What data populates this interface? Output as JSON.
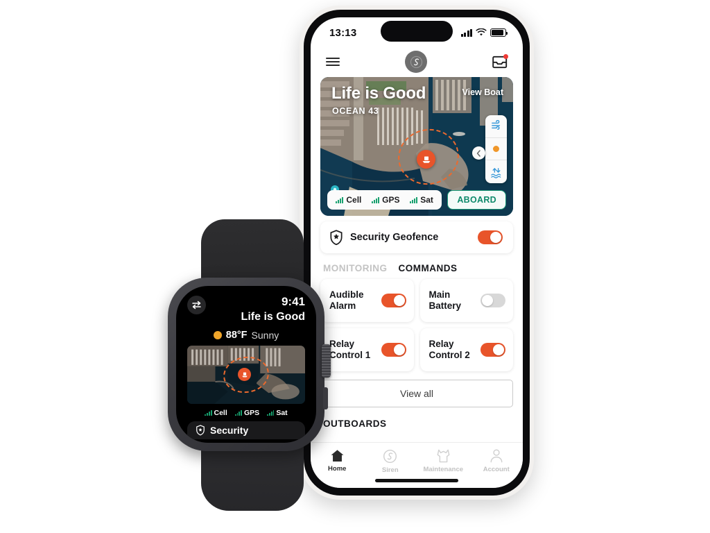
{
  "phone": {
    "status_bar": {
      "time": "13:13",
      "signal_icon": "cellular-bars-icon",
      "wifi_icon": "wifi-icon",
      "battery_icon": "battery-icon"
    },
    "header": {
      "menu_icon": "hamburger-menu-icon",
      "logo_icon": "siren-marine-logo-icon",
      "inbox_icon": "inbox-icon",
      "notification_badge": ""
    },
    "map_card": {
      "boat_name": "Life is Good",
      "boat_model": "OCEAN 43",
      "view_boat_label": "View Boat",
      "wind_icon": "wind-icon",
      "layer_dot_icon": "current-layer-dot-icon",
      "tide_icon": "tide-levels-icon",
      "collapse_icon": "chevron-left-icon",
      "boat_marker_icon": "boat-marker-icon",
      "geofence_ring": "geofence-dashed-circle",
      "map_pin_icon": "map-pin-icon",
      "signals": [
        {
          "label": "Cell",
          "icon": "signal-bars-icon"
        },
        {
          "label": "GPS",
          "icon": "signal-bars-icon"
        },
        {
          "label": "Sat",
          "icon": "signal-bars-icon"
        }
      ],
      "aboard_badge": "ABOARD"
    },
    "geofence_row": {
      "icon": "shield-star-icon",
      "label": "Security Geofence",
      "toggle_state": "on"
    },
    "tabs": [
      {
        "label": "MONITORING",
        "active": false
      },
      {
        "label": "COMMANDS",
        "active": true
      }
    ],
    "commands": [
      {
        "label": "Audible Alarm",
        "toggle_state": "on"
      },
      {
        "label": "Main Battery",
        "toggle_state": "off"
      },
      {
        "label": "Relay Control 1",
        "toggle_state": "on"
      },
      {
        "label": "Relay Control 2",
        "toggle_state": "on"
      }
    ],
    "view_all_label": "View all",
    "outboards_heading": "OUTBOARDS",
    "tabbar": [
      {
        "label": "Home",
        "icon": "home-icon",
        "active": true
      },
      {
        "label": "Siren",
        "icon": "siren-swirl-icon",
        "active": false
      },
      {
        "label": "Maintenance",
        "icon": "maintenance-wrench-icon",
        "active": false
      },
      {
        "label": "Account",
        "icon": "account-person-icon",
        "active": false
      }
    ]
  },
  "watch": {
    "swap_icon": "swap-arrows-icon",
    "time": "9:41",
    "boat_name": "Life is Good",
    "weather": {
      "icon": "sun-icon",
      "temperature": "88°F",
      "condition": "Sunny"
    },
    "map": {
      "boat_marker_icon": "boat-marker-icon",
      "geofence_ring": "geofence-dashed-circle"
    },
    "signals": [
      {
        "label": "Cell",
        "icon": "signal-bars-icon"
      },
      {
        "label": "GPS",
        "icon": "signal-bars-icon"
      },
      {
        "label": "Sat",
        "icon": "signal-bars-icon"
      }
    ],
    "bottom_card": {
      "icon": "shield-star-icon",
      "label": "Security"
    }
  },
  "colors": {
    "accent_orange": "#e8542a",
    "aboard_green": "#0e8a6b",
    "signal_green": "#17a06e",
    "sun_yellow": "#f0a52a",
    "map_control_blue": "#3b9ad9",
    "notification_red": "#ef3b36"
  }
}
